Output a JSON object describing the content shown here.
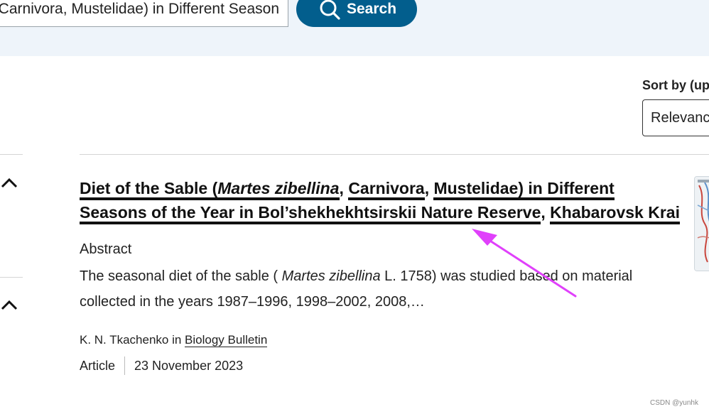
{
  "search": {
    "query": "Diet of the Sable (Martes zibellina, Carnivora, Mustelidae) in Different Season",
    "button_label": "Search",
    "button_color": "#025e8d",
    "icon": "search-icon"
  },
  "sort": {
    "label": "Sort by (up",
    "selected": "Relevanc"
  },
  "result": {
    "title_part1": "Diet of the Sable (",
    "title_species": "Martes zibellina",
    "title_part2": "Carnivora",
    "title_part3": "Mustelidae) in Different Seasons of the Year in Bol’shekhekhtsirskii Nature Reserve",
    "title_part4": "Khabarovsk Krai",
    "title_comma": ",",
    "abstract_heading": "Abstract",
    "abstract_prefix": "The seasonal diet of the sable ( ",
    "abstract_species": "Martes zibellina",
    "abstract_suffix": " L. 1758) was studied based on material collected in the years 1987–1996, 1998–2002, 2008,…",
    "authors": "K. N. Tkachenko",
    "authors_connector": " in ",
    "journal": "Biology Bulletin",
    "content_type": "Article",
    "date": "23 November 2023"
  },
  "annotation": {
    "arrow_color": "#e040fb"
  },
  "watermark": "CSDN @yunhk"
}
